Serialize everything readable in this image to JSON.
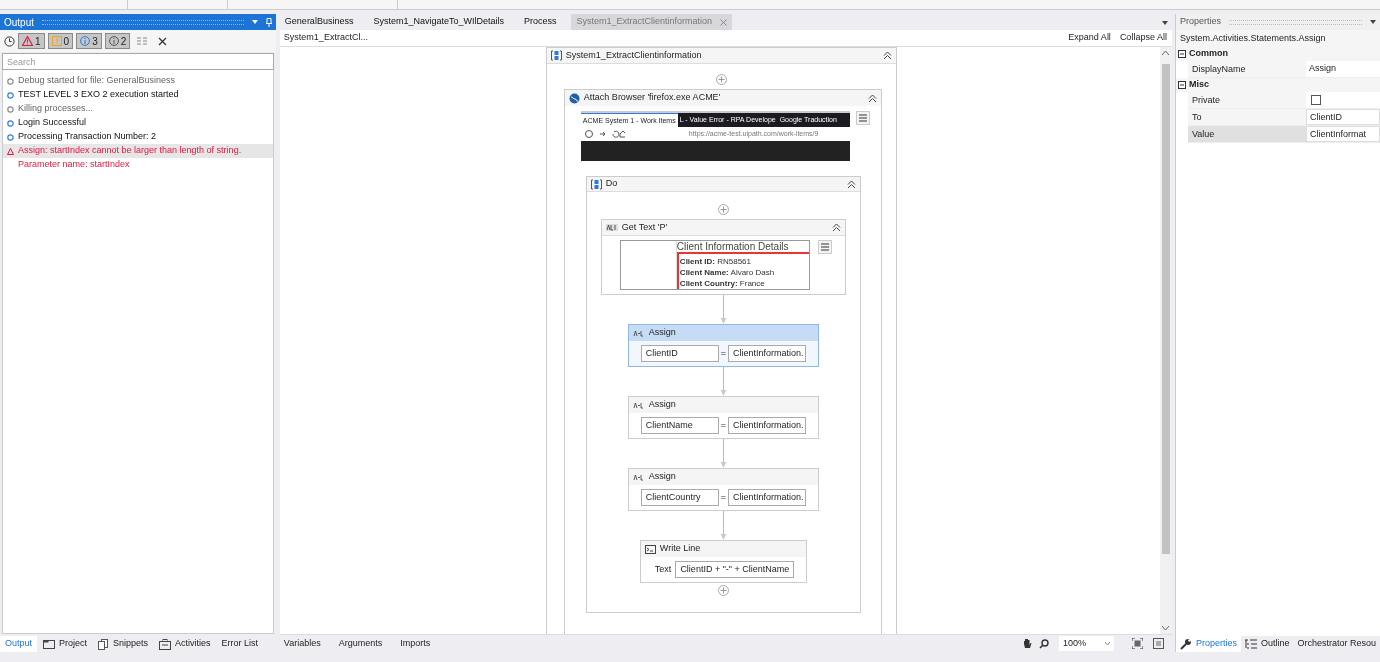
{
  "output_panel": {
    "title": "Output",
    "filters": [
      {
        "kind": "error",
        "count": "1",
        "selected": true
      },
      {
        "kind": "warning",
        "count": "0",
        "selected": true
      },
      {
        "kind": "info",
        "count": "3",
        "selected": true
      },
      {
        "kind": "trace",
        "count": "2",
        "selected": true
      }
    ],
    "search": {
      "placeholder": "Search"
    },
    "messages": [
      {
        "kind": "trace",
        "text": "Debug started for file: GeneralBusiness",
        "selected": false
      },
      {
        "kind": "info",
        "text": "TEST LEVEL 3 EXO 2 execution started",
        "selected": false
      },
      {
        "kind": "trace",
        "text": "Killing processes...",
        "selected": false
      },
      {
        "kind": "info",
        "text": "Login Successful",
        "selected": false
      },
      {
        "kind": "info",
        "text": "Processing Transaction Number: 2",
        "selected": false
      },
      {
        "kind": "error",
        "text": "Assign: startIndex cannot be larger than length of string.",
        "selected": true
      },
      {
        "kind": "error_detail",
        "text": "Parameter name: startIndex",
        "selected": false
      }
    ],
    "bottom_tabs": [
      {
        "label": "Output",
        "selected": true
      },
      {
        "label": "Project",
        "selected": false
      },
      {
        "label": "Snippets",
        "selected": false
      },
      {
        "label": "Activities",
        "selected": false
      },
      {
        "label": "Error List",
        "selected": false
      }
    ]
  },
  "designer": {
    "tabs": [
      {
        "label": "GeneralBusiness",
        "selected": false
      },
      {
        "label": "System1_NavigateTo_WIlDetails",
        "selected": false
      },
      {
        "label": "Process",
        "selected": false
      },
      {
        "label": "System1_ExtractClientinformation",
        "selected": true
      }
    ],
    "breadcrumb": "System1_ExtractCl...",
    "actions": [
      "Expand All",
      "Collapse All"
    ],
    "workflow": {
      "title": "System1_ExtractClientinformation",
      "attach": {
        "title": "Attach Browser 'firefox.exe ACME'",
        "browser": {
          "tabs": [
            {
              "label": "ACME System 1 - Work Items",
              "selected": true
            },
            {
              "label": "L - Value Error - RPA Develope",
              "selected": false
            },
            {
              "label": "Google Traduction",
              "selected": false
            }
          ],
          "url": "https://acme-test.uipath.com/work-items/9"
        },
        "do": {
          "title": "Do",
          "activities": [
            {
              "kind": "get_text",
              "title": "Get Text 'P'",
              "heading": "Client Information Details",
              "lines": [
                "**Client ID:** RN58561",
                "**Client Name:** Alvaro Dash",
                "**Client Country:** France"
              ]
            },
            {
              "kind": "assign",
              "title": "Assign",
              "to": "ClientID",
              "operator": "=",
              "value": "ClientInformation.",
              "selected": true
            },
            {
              "kind": "assign",
              "title": "Assign",
              "to": "ClientName",
              "operator": "=",
              "value": "ClientInformation.",
              "selected": false
            },
            {
              "kind": "assign",
              "title": "Assign",
              "to": "ClientCountry",
              "operator": "=",
              "value": "ClientInformation.",
              "selected": false
            },
            {
              "kind": "write_line",
              "title": "Write Line",
              "label": "Text",
              "value": "ClientID + \"-\" + ClientName"
            }
          ]
        }
      }
    },
    "bottom_tabs": [
      "Variables",
      "Arguments",
      "Imports"
    ],
    "zoom": "100%"
  },
  "properties": {
    "title": "Properties",
    "type": "System.Activities.Statements.Assign",
    "categories": [
      {
        "name": "Common",
        "expanded": true,
        "rows": [
          {
            "kind": "text",
            "label": "DisplayName",
            "value": "Assign",
            "selected": false
          }
        ]
      },
      {
        "name": "Misc",
        "expanded": true,
        "rows": [
          {
            "kind": "checkbox",
            "label": "Private",
            "checked": false,
            "selected": false
          },
          {
            "kind": "field",
            "label": "To",
            "value": "ClientID",
            "selected": false
          },
          {
            "kind": "field",
            "label": "Value",
            "value": "ClientInformat",
            "selected": true
          }
        ]
      }
    ],
    "bottom_tabs": [
      {
        "label": "Properties",
        "selected": true
      },
      {
        "label": "Outline",
        "selected": false
      },
      {
        "label": "Orchestrator Resou",
        "selected": false
      }
    ]
  }
}
